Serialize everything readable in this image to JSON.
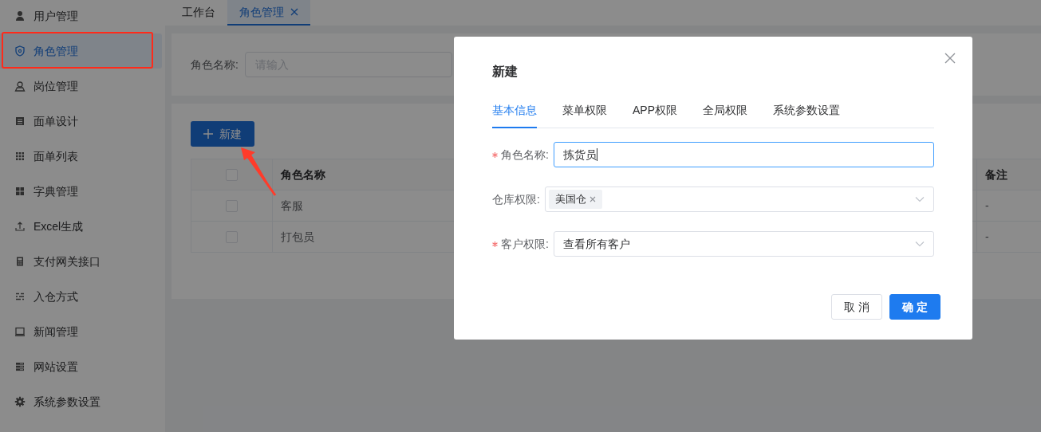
{
  "sidebar": {
    "items": [
      {
        "label": "用户管理",
        "selected": false
      },
      {
        "label": "角色管理",
        "selected": true
      },
      {
        "label": "岗位管理",
        "selected": false
      },
      {
        "label": "面单设计",
        "selected": false
      },
      {
        "label": "面单列表",
        "selected": false
      },
      {
        "label": "字典管理",
        "selected": false
      },
      {
        "label": "Excel生成",
        "selected": false
      },
      {
        "label": "支付网关接口",
        "selected": false
      },
      {
        "label": "入仓方式",
        "selected": false
      },
      {
        "label": "新闻管理",
        "selected": false
      },
      {
        "label": "网站设置",
        "selected": false
      },
      {
        "label": "系统参数设置",
        "selected": false
      }
    ]
  },
  "tabs": [
    {
      "label": "工作台",
      "selected": false,
      "closable": false
    },
    {
      "label": "角色管理",
      "selected": true,
      "closable": true
    }
  ],
  "search": {
    "label": "角色名称:",
    "placeholder": "请输入"
  },
  "new_button": {
    "label": "新建"
  },
  "table": {
    "header_checked": false,
    "columns": [
      "角色名称",
      "备注"
    ],
    "rows": [
      {
        "checked": false,
        "name": "客服",
        "note": "-"
      },
      {
        "checked": false,
        "name": "打包员",
        "note": "-"
      }
    ]
  },
  "dialog": {
    "title": "新建",
    "tabs": [
      {
        "label": "基本信息",
        "selected": true
      },
      {
        "label": "菜单权限",
        "selected": false
      },
      {
        "label": "APP权限",
        "selected": false
      },
      {
        "label": "全局权限",
        "selected": false
      },
      {
        "label": "系统参数设置",
        "selected": false
      }
    ],
    "fields": [
      {
        "kind": "text",
        "required": true,
        "label": "角色名称:",
        "value": "拣货员",
        "focused": true
      },
      {
        "kind": "tags",
        "required": false,
        "label": "仓库权限:",
        "tags": [
          "美国仓"
        ]
      },
      {
        "kind": "select",
        "required": true,
        "label": "客户权限:",
        "value": "查看所有客户"
      }
    ],
    "buttons": [
      {
        "kind": "default",
        "label": "取 消"
      },
      {
        "kind": "primary",
        "label": "确 定"
      }
    ]
  }
}
